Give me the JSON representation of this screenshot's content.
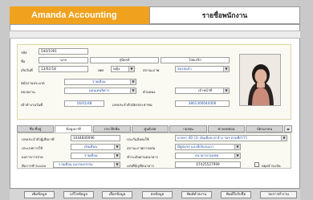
{
  "app": {
    "title": "Amanda Accounting",
    "page_title": "รายชื่อพนักงาน"
  },
  "personal": {
    "code_label": "รหัส",
    "code_value": "540/1001",
    "name_label": "ชื่อ",
    "prefix": "นาย",
    "first_name": "สุนิทรย์",
    "last_name": "ไสยเกริก",
    "birth_label": "เกิดวันที่",
    "birth_date": "13/02/18",
    "sex_label": "เพศ",
    "sex_value": "หญิง",
    "marital_label": "สถานะภาพ",
    "marital_value": "สมรสแล้ว",
    "staff_type_label": "พนักงานประเภท",
    "staff_type_value": "รายเดือน",
    "dept_label": "หน่วยงาน",
    "dept_value": "มอนเทนจิทาร",
    "position_label": "ตำแหน่ง",
    "position_value": "เจ้าหน้าที่",
    "start_label": "เข้าทำงานวันที่",
    "start_date": "16/01/48",
    "id_label": "เลขประจำตัวบัตรประชาชน",
    "id_value": "3801300044406"
  },
  "tabs": [
    {
      "label": "ชื่อ-ที่อยู่"
    },
    {
      "label": "ข้อมูลภาษี"
    },
    {
      "label": "ประวัติเพิ่ม"
    },
    {
      "label": "ศูนย์เขต"
    },
    {
      "label": "กองทุน"
    },
    {
      "label": "ค่าลดหย่อน"
    },
    {
      "label": "บัตรเงาคน"
    }
  ],
  "tab_nav": {
    "label": "◂▸"
  },
  "tax": {
    "taxid_label": "เลขประจำตัวผู้เสียภาษี",
    "taxid_value": "1044840096",
    "social_label": "ประกันสังคมใช้",
    "social_value": "มาตรา 40 (1) เงินเดือน ค่าจ้าง ฯลฯ ตามที่กำไว้",
    "calc_label": "ประเภทการใช้",
    "calc_value": "เงินเดือน",
    "account_label": "สถานะภาพการผสม",
    "account_value": "มีคู่สมรส และมีเงินรบเบา",
    "pay_label": "ผลการการจ่าย",
    "pay_value": "รายเดือน",
    "bank_label": "ชำระเงินผ่านธนาคาร",
    "bank_value": "ธนาคารกรุงเทพ",
    "payment_label": "คือการชำระแบบ",
    "payment_value": "รายเดือน มบรรมกรรรม",
    "account_no_label": "เลขที่บัญชีธนาคาร",
    "account_no_value": "07425527999",
    "stop_label": "หยุดจำระเงิน"
  },
  "buttons": {
    "add": "เพิ่มข้อมูล",
    "edit": "แก้ไขข้อมูล",
    "select": "เลือกข้อมูล",
    "delete": "ลบข้อมูล",
    "print_card": "พิมพ์ทำลงาน",
    "print_list": "พิมพ์ใบรับชื่อ",
    "close": "จบการทำงาน"
  }
}
